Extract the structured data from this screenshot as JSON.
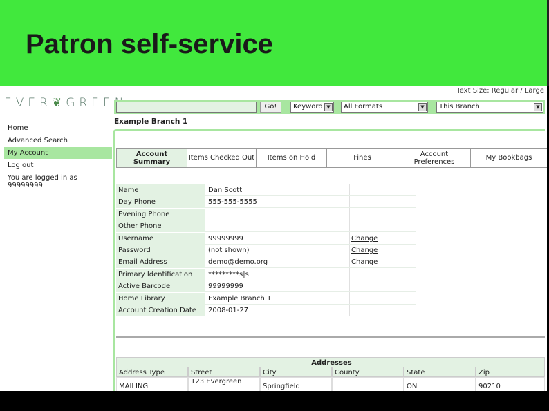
{
  "slide_title": "Patron self-service",
  "logo_text": "EVERGREEN",
  "text_size": "Text Size: Regular / Large",
  "search": {
    "value": "",
    "go": "Go!",
    "type": "Keyword",
    "format": "All Formats",
    "scope": "This Branch"
  },
  "sidebar": {
    "items": [
      {
        "label": "Home"
      },
      {
        "label": "Advanced Search"
      },
      {
        "label": "My Account"
      },
      {
        "label": "Log out"
      }
    ],
    "logged_in": "You are logged in as",
    "user": "99999999"
  },
  "branch": "Example Branch 1",
  "tabs": [
    {
      "label": "Account Summary"
    },
    {
      "label": "Items Checked Out"
    },
    {
      "label": "Items on Hold"
    },
    {
      "label": "Fines"
    },
    {
      "label": "Account Preferences"
    },
    {
      "label": "My Bookbags"
    }
  ],
  "info": [
    {
      "label": "Name",
      "value": "Dan    Scott",
      "change": ""
    },
    {
      "label": "Day Phone",
      "value": "555-555-5555",
      "change": ""
    },
    {
      "label": "Evening Phone",
      "value": "",
      "change": ""
    },
    {
      "label": "Other Phone",
      "value": "",
      "change": ""
    },
    {
      "label": "Username",
      "value": "99999999",
      "change": "Change"
    },
    {
      "label": "Password",
      "value": "(not shown)",
      "change": "Change"
    },
    {
      "label": "Email Address",
      "value": "demo@demo.org",
      "change": "Change"
    },
    {
      "label": "Primary Identification",
      "value": "*********s|s|",
      "change": ""
    },
    {
      "label": "Active Barcode",
      "value": "99999999",
      "change": ""
    },
    {
      "label": "Home Library",
      "value": "Example Branch 1",
      "change": ""
    },
    {
      "label": "Account Creation Date",
      "value": "2008-01-27",
      "change": ""
    }
  ],
  "addresses": {
    "title": "Addresses",
    "columns": [
      "Address Type",
      "Street",
      "City",
      "County",
      "State",
      "Zip"
    ],
    "rows": [
      [
        "MAILING",
        "123 Evergreen",
        "Springfield",
        "",
        "ON",
        "90210"
      ]
    ]
  }
}
